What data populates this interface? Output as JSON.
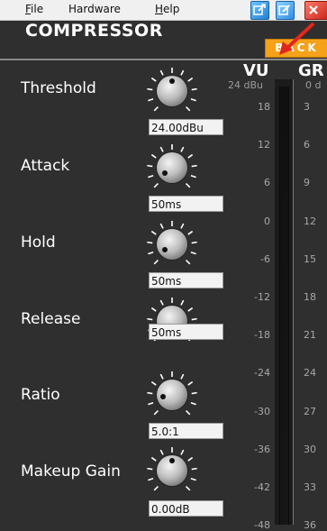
{
  "menu": {
    "file": "File",
    "hardware": "Hardware",
    "help": "Help"
  },
  "title": "COMPRESSOR",
  "back_button": "BACK",
  "controls": [
    {
      "name": "Threshold",
      "value": "24.00dBu"
    },
    {
      "name": "Attack",
      "value": "50ms"
    },
    {
      "name": "Hold",
      "value": "50ms"
    },
    {
      "name": "Release",
      "value": "50ms"
    },
    {
      "name": "Ratio",
      "value": "5.0:1"
    },
    {
      "name": "Makeup Gain",
      "value": "0.00dB"
    }
  ],
  "meter": {
    "vu_label": "VU",
    "gr_label": "GR",
    "vu_unit": "24 dBu",
    "gr_unit": "0 d",
    "vu_ticks": [
      "18",
      "12",
      "6",
      "0",
      "-6",
      "-12",
      "-18",
      "-24",
      "-30",
      "-36",
      "-42",
      "-48"
    ],
    "gr_ticks": [
      "3",
      "6",
      "9",
      "12",
      "15",
      "18",
      "21",
      "24",
      "27",
      "30",
      "33",
      "36"
    ]
  },
  "colors": {
    "back_button": "#f5a21a",
    "background": "#2f2f2f"
  }
}
